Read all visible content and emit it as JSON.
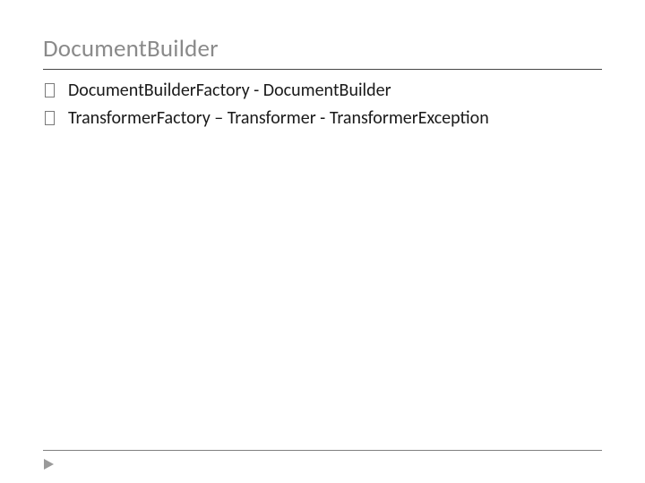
{
  "title": "DocumentBuilder",
  "bullets": [
    "DocumentBuilderFactory - DocumentBuilder",
    "TransformerFactory – Transformer - TransformerException"
  ]
}
